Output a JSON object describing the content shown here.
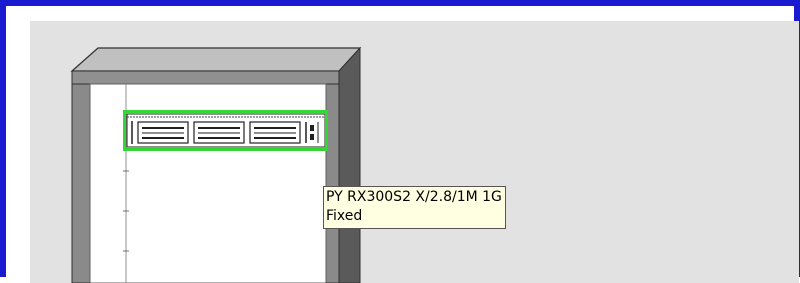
{
  "tooltip": {
    "model": "PY RX300S2 X/2.8/1M 1G",
    "status": "Fixed"
  },
  "colors": {
    "frame_border": "#1a1ad0",
    "canvas_bg": "#e2e2e2",
    "rack_frame": "#808080",
    "rack_side": "#5a5a5a",
    "selection": "#33d633",
    "tooltip_bg": "#ffffe1"
  },
  "icons": [
    "rack-cabinet",
    "server-unit"
  ]
}
